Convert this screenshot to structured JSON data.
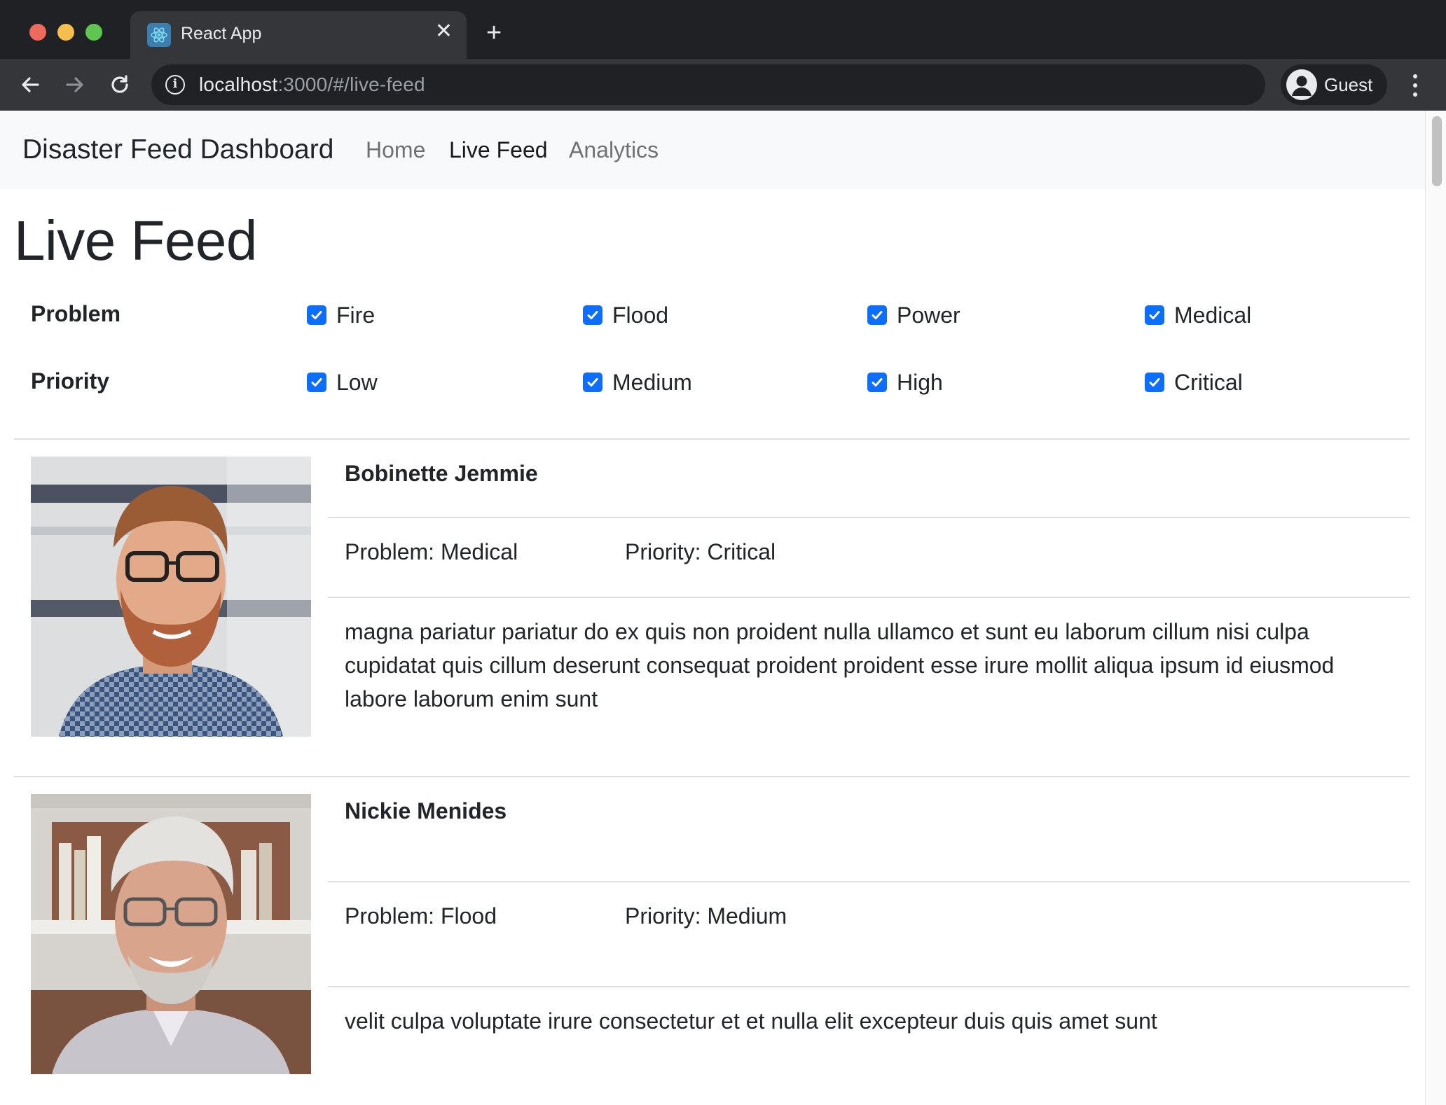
{
  "browser": {
    "tab_title": "React App",
    "url_host": "localhost",
    "url_path": ":3000/#/live-feed",
    "profile_label": "Guest"
  },
  "navbar": {
    "brand": "Disaster Feed Dashboard",
    "links": [
      {
        "label": "Home",
        "active": false
      },
      {
        "label": "Live Feed",
        "active": true
      },
      {
        "label": "Analytics",
        "active": false
      }
    ]
  },
  "page": {
    "title": "Live Feed"
  },
  "filters": {
    "problem": {
      "label": "Problem",
      "options": [
        {
          "label": "Fire",
          "checked": true
        },
        {
          "label": "Flood",
          "checked": true
        },
        {
          "label": "Power",
          "checked": true
        },
        {
          "label": "Medical",
          "checked": true
        }
      ]
    },
    "priority": {
      "label": "Priority",
      "options": [
        {
          "label": "Low",
          "checked": true
        },
        {
          "label": "Medium",
          "checked": true
        },
        {
          "label": "High",
          "checked": true
        },
        {
          "label": "Critical",
          "checked": true
        }
      ]
    }
  },
  "feed": [
    {
      "name": "Bobinette Jemmie",
      "problem": "Problem: Medical",
      "priority": "Priority: Critical",
      "description": "magna pariatur pariatur do ex quis non proident nulla ullamco et sunt eu laborum cillum nisi culpa cupidatat quis cillum deserunt consequat proident proident esse irure mollit aliqua ipsum id eiusmod labore laborum enim sunt"
    },
    {
      "name": "Nickie Menides",
      "problem": "Problem: Flood",
      "priority": "Priority: Medium",
      "description": "velit culpa voluptate irure consectetur et et nulla elit excepteur duis quis amet sunt"
    }
  ],
  "colors": {
    "checkbox": "#0d6efd",
    "navbar_bg": "#f8f9fa",
    "chrome_bg": "#202124",
    "toolbar_bg": "#35363a"
  }
}
